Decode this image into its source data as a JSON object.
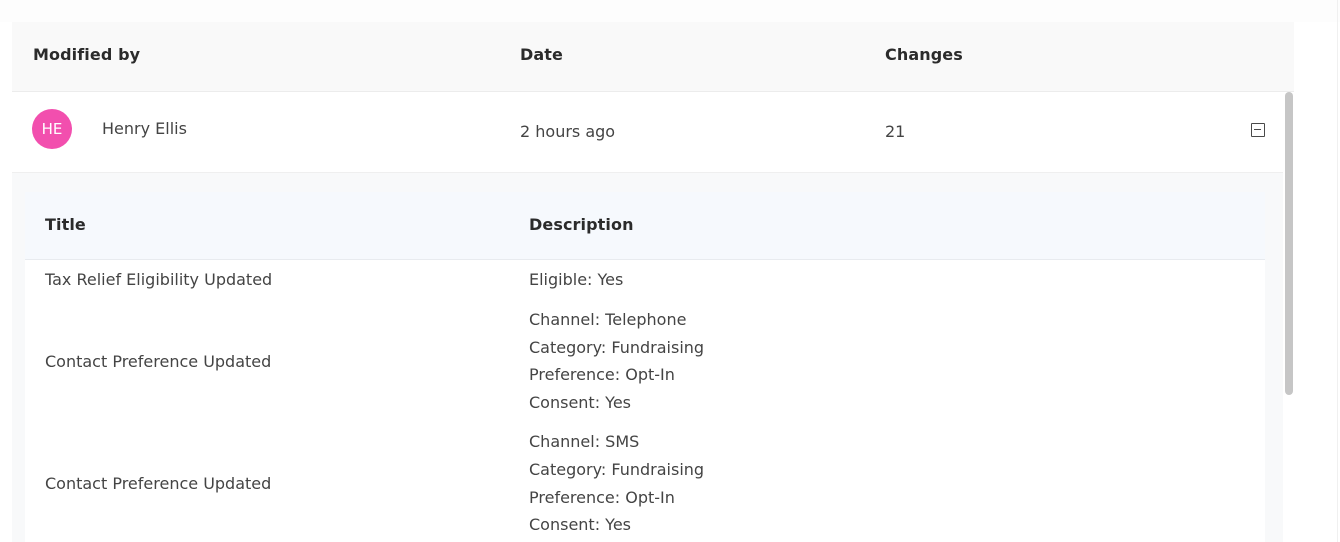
{
  "table": {
    "headers": {
      "modified_by": "Modified by",
      "date": "Date",
      "changes": "Changes"
    },
    "rows": [
      {
        "avatar_initials": "HE",
        "avatar_color": "#f24fae",
        "name": "Henry Ellis",
        "date": "2 hours ago",
        "changes": "21",
        "expanded": true,
        "collapse_icon": "minus-square-icon"
      }
    ]
  },
  "details": {
    "headers": {
      "title": "Title",
      "description": "Description"
    },
    "items": [
      {
        "title": "Tax Relief Eligibility Updated",
        "description": [
          "Eligible: Yes"
        ]
      },
      {
        "title": "Contact Preference Updated",
        "description": [
          "Channel: Telephone",
          "Category: Fundraising",
          "Preference: Opt-In",
          "Consent: Yes"
        ]
      },
      {
        "title": "Contact Preference Updated",
        "description": [
          "Channel: SMS",
          "Category: Fundraising",
          "Preference: Opt-In",
          "Consent: Yes"
        ]
      }
    ]
  }
}
